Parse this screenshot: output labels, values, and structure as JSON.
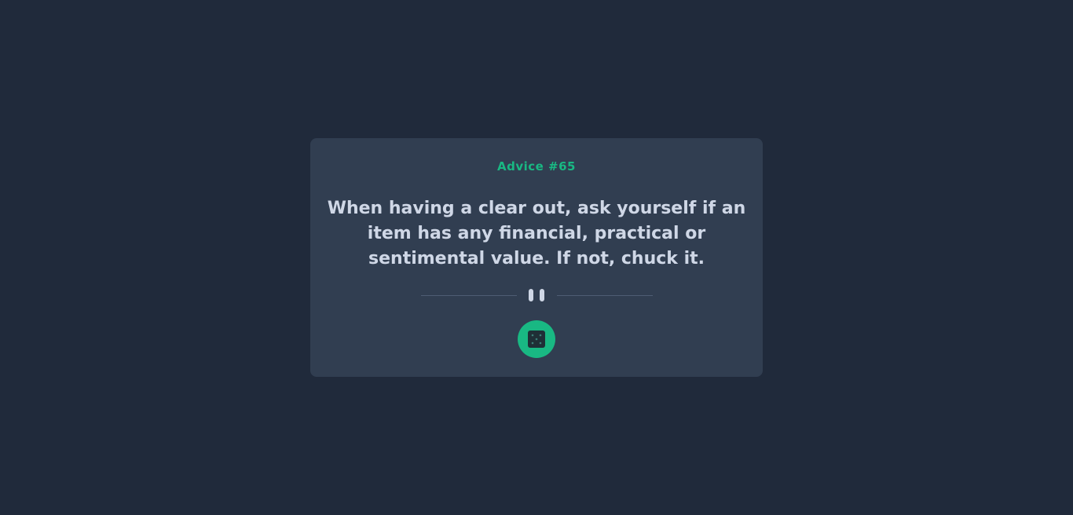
{
  "advice": {
    "id_label": "Advice #65",
    "text": "When having a clear out, ask yourself if an item has any financial, practical or sentimental value. If not, chuck it."
  },
  "divider": {
    "icon": "pause-icon"
  },
  "dice_button": {
    "icon": "dice-icon"
  },
  "colors": {
    "background": "#202a3b",
    "card": "#313e51",
    "accent": "#52ffa8",
    "accent_muted": "#19b883",
    "text": "#cfd7e6",
    "dice": "#1f2f36"
  }
}
